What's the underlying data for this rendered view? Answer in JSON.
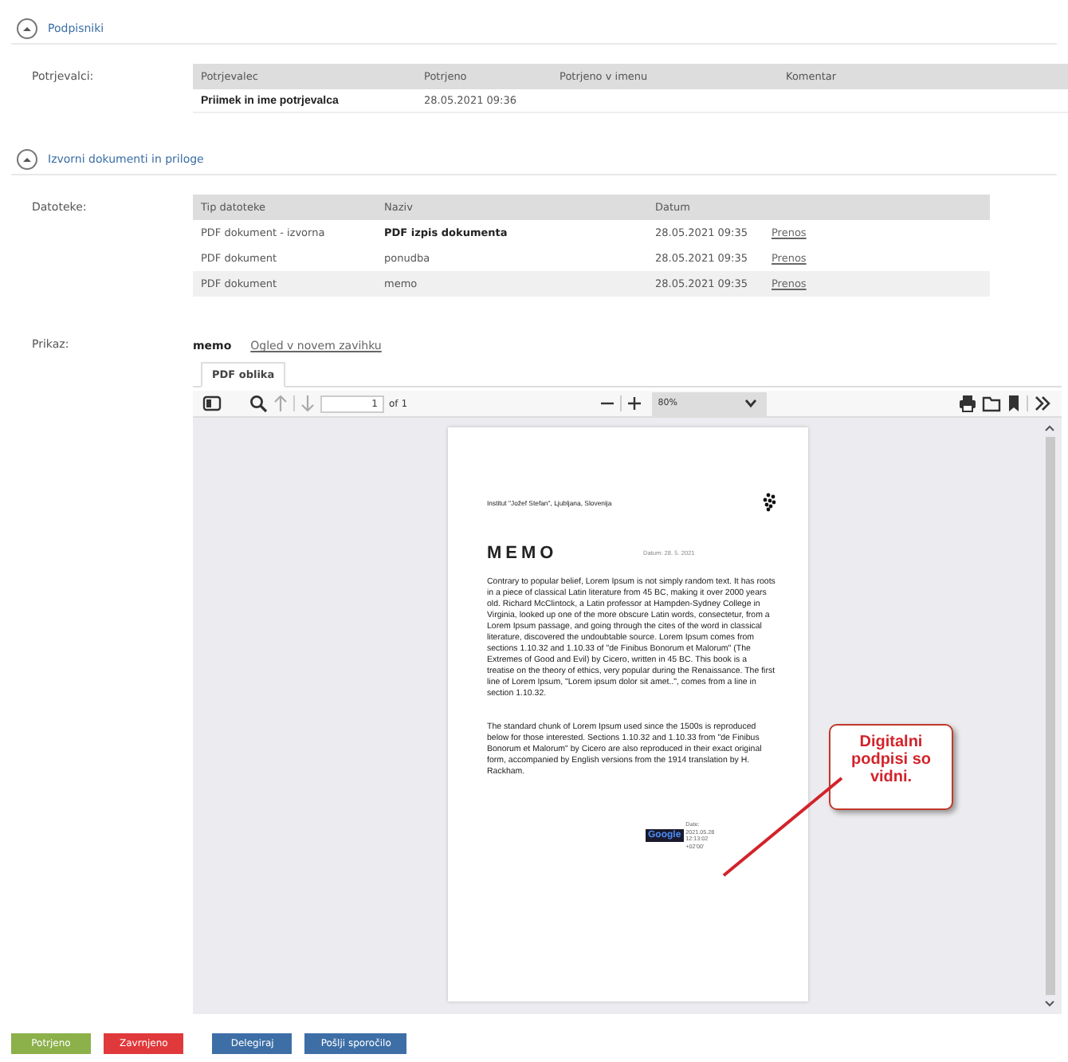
{
  "signers_section": {
    "title": "Podpisniki",
    "expanded": true,
    "label": "Potrjevalci:",
    "table": {
      "columns": [
        "Potrjevalec",
        "Potrjeno",
        "Potrjeno v imenu",
        "Komentar"
      ],
      "rows": [
        {
          "cells": [
            "Priimek in ime potrjevalca",
            "28.05.2021 09:36"
          ]
        }
      ]
    }
  },
  "documents_section": {
    "title": "Izvorni dokumenti in priloge",
    "expanded": true,
    "label": "Datoteke:",
    "table": {
      "columns": [
        "Tip datoteke",
        "Naziv",
        "Datum"
      ],
      "rows": [
        {
          "type": "PDF dokument - izvorna",
          "name": "PDF izpis dokumenta",
          "emphasized": true,
          "date": "28.05.2021 09:35",
          "action": "Prenos",
          "selected": false
        },
        {
          "type": "PDF dokument",
          "name": "ponudba",
          "emphasized": false,
          "date": "28.05.2021 09:35",
          "action": "Prenos",
          "selected": false
        },
        {
          "type": "PDF dokument",
          "name": "memo",
          "emphasized": false,
          "date": "28.05.2021 09:35",
          "action": "Prenos",
          "selected": true
        }
      ]
    }
  },
  "preview": {
    "label": "Prikaz:",
    "current": "memo",
    "open_link": "Ogled v novem zavihku",
    "tabs": [
      {
        "label": "PDF oblika",
        "selected": true
      }
    ],
    "viewer": {
      "page_input": "1",
      "page_count": "of 1",
      "zoom": "80%",
      "document": {
        "organization": "Institut \"Jožef Stefan\", Ljubljana, Slovenija",
        "title": "MEMO",
        "date": "Datum: 28. 5. 2021",
        "paragraphs": [
          "Contrary to popular belief, Lorem Ipsum is not simply random text. It has roots in a piece of classical Latin literature from 45 BC, making it over 2000 years old. Richard McClintock, a Latin professor at Hampden-Sydney College in Virginia, looked up one of the more obscure Latin words, consectetur, from a Lorem Ipsum passage, and going through the cites of the word in classical literature, discovered the undoubtable source. Lorem Ipsum comes from sections 1.10.32 and 1.10.33 of \"de Finibus Bonorum et Malorum\" (The Extremes of Good and Evil) by Cicero, written in 45 BC. This book is a treatise on the theory of ethics, very popular during the Renaissance. The first line of Lorem Ipsum, \"Lorem ipsum dolor sit amet..\", comes from a line in section 1.10.32.",
          "The standard chunk of Lorem Ipsum used since the 1500s is reproduced below for those interested. Sections 1.10.32 and 1.10.33 from \"de Finibus Bonorum et Malorum\" by Cicero are also reproduced in their exact original form, accompanied by English versions from the 1914 translation by H. Rackham."
        ],
        "signature": {
          "logo": "Google",
          "lines": [
            "Date:",
            "2021.05.28",
            "12:13:02",
            "+02'00'"
          ]
        }
      },
      "callout": "Digitalni podpisi so vidni."
    }
  },
  "buttons": [
    {
      "label": "Potrjeno",
      "kind": "approve"
    },
    {
      "label": "Zavrnjeno",
      "kind": "reject"
    },
    {
      "label": "Delegiraj",
      "kind": "primary"
    },
    {
      "label": "Pošlji sporočilo",
      "kind": "primary"
    }
  ]
}
